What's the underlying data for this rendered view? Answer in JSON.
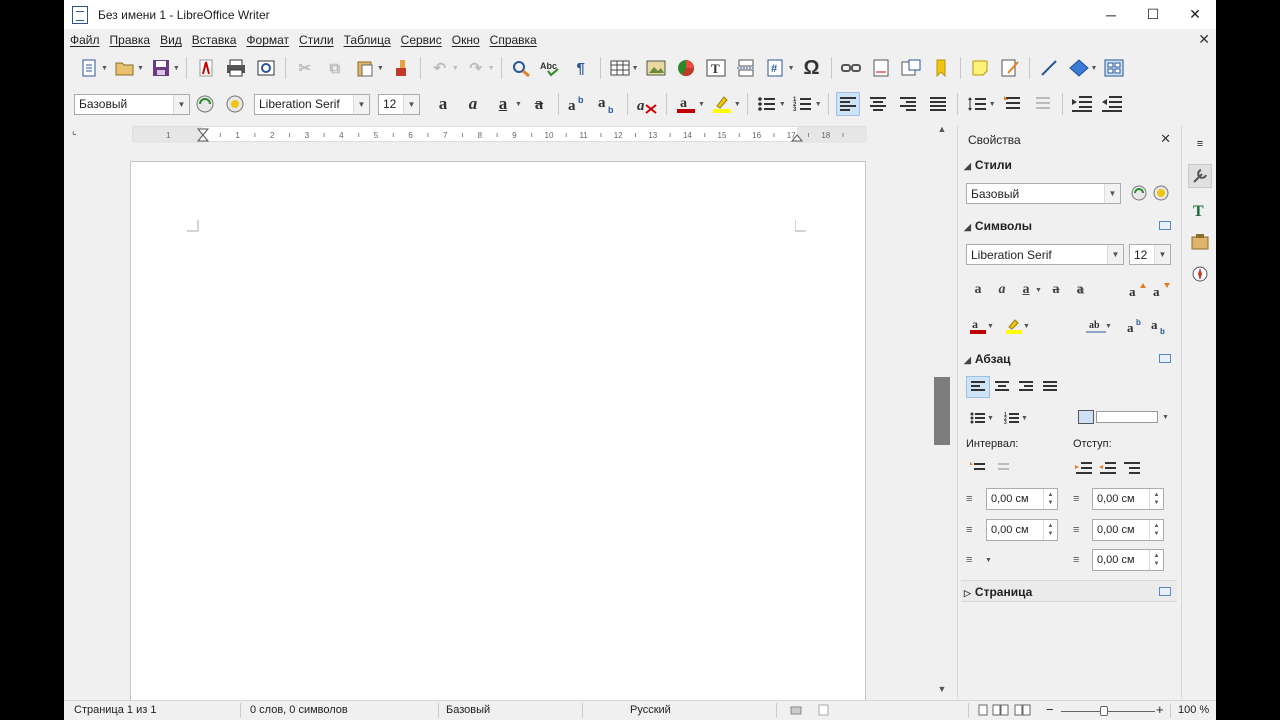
{
  "window": {
    "title": "Без имени 1 - LibreOffice Writer",
    "minimize": "─",
    "maximize": "☐",
    "close": "✕",
    "doc_close": "✕"
  },
  "menu": [
    "Файл",
    "Правка",
    "Вид",
    "Вставка",
    "Формат",
    "Стили",
    "Таблица",
    "Сервис",
    "Окно",
    "Справка"
  ],
  "formatting": {
    "paragraph_style": "Базовый",
    "font_name": "Liberation Serif",
    "font_size": "12"
  },
  "ruler": {
    "ticks": [
      "1",
      "1",
      "2",
      "3",
      "4",
      "5",
      "6",
      "7",
      "8",
      "9",
      "10",
      "11",
      "12",
      "13",
      "14",
      "15",
      "16",
      "17",
      "18"
    ]
  },
  "sidebar": {
    "title": "Свойства",
    "close": "✕",
    "styles": {
      "header": "Стили",
      "value": "Базовый"
    },
    "symbols": {
      "header": "Символы",
      "font": "Liberation Serif",
      "size": "12"
    },
    "paragraph": {
      "header": "Абзац",
      "spacing_label": "Интервал:",
      "indent_label": "Отступ:",
      "above": "0,00 см",
      "below": "0,00 см",
      "before_text": "0,00 см",
      "after_text": "0,00 см",
      "first_line": "0,00 см"
    },
    "page": {
      "header": "Страница"
    }
  },
  "status": {
    "page": "Страница 1 из 1",
    "words": "0 слов, 0 символов",
    "style": "Базовый",
    "language": "Русский",
    "zoom": "100 %",
    "zoom_minus": "−",
    "zoom_plus": "+"
  },
  "colors": {
    "font_color": "#c00000",
    "highlight": "#ffff00",
    "active_blue": "#cfe3f7"
  }
}
